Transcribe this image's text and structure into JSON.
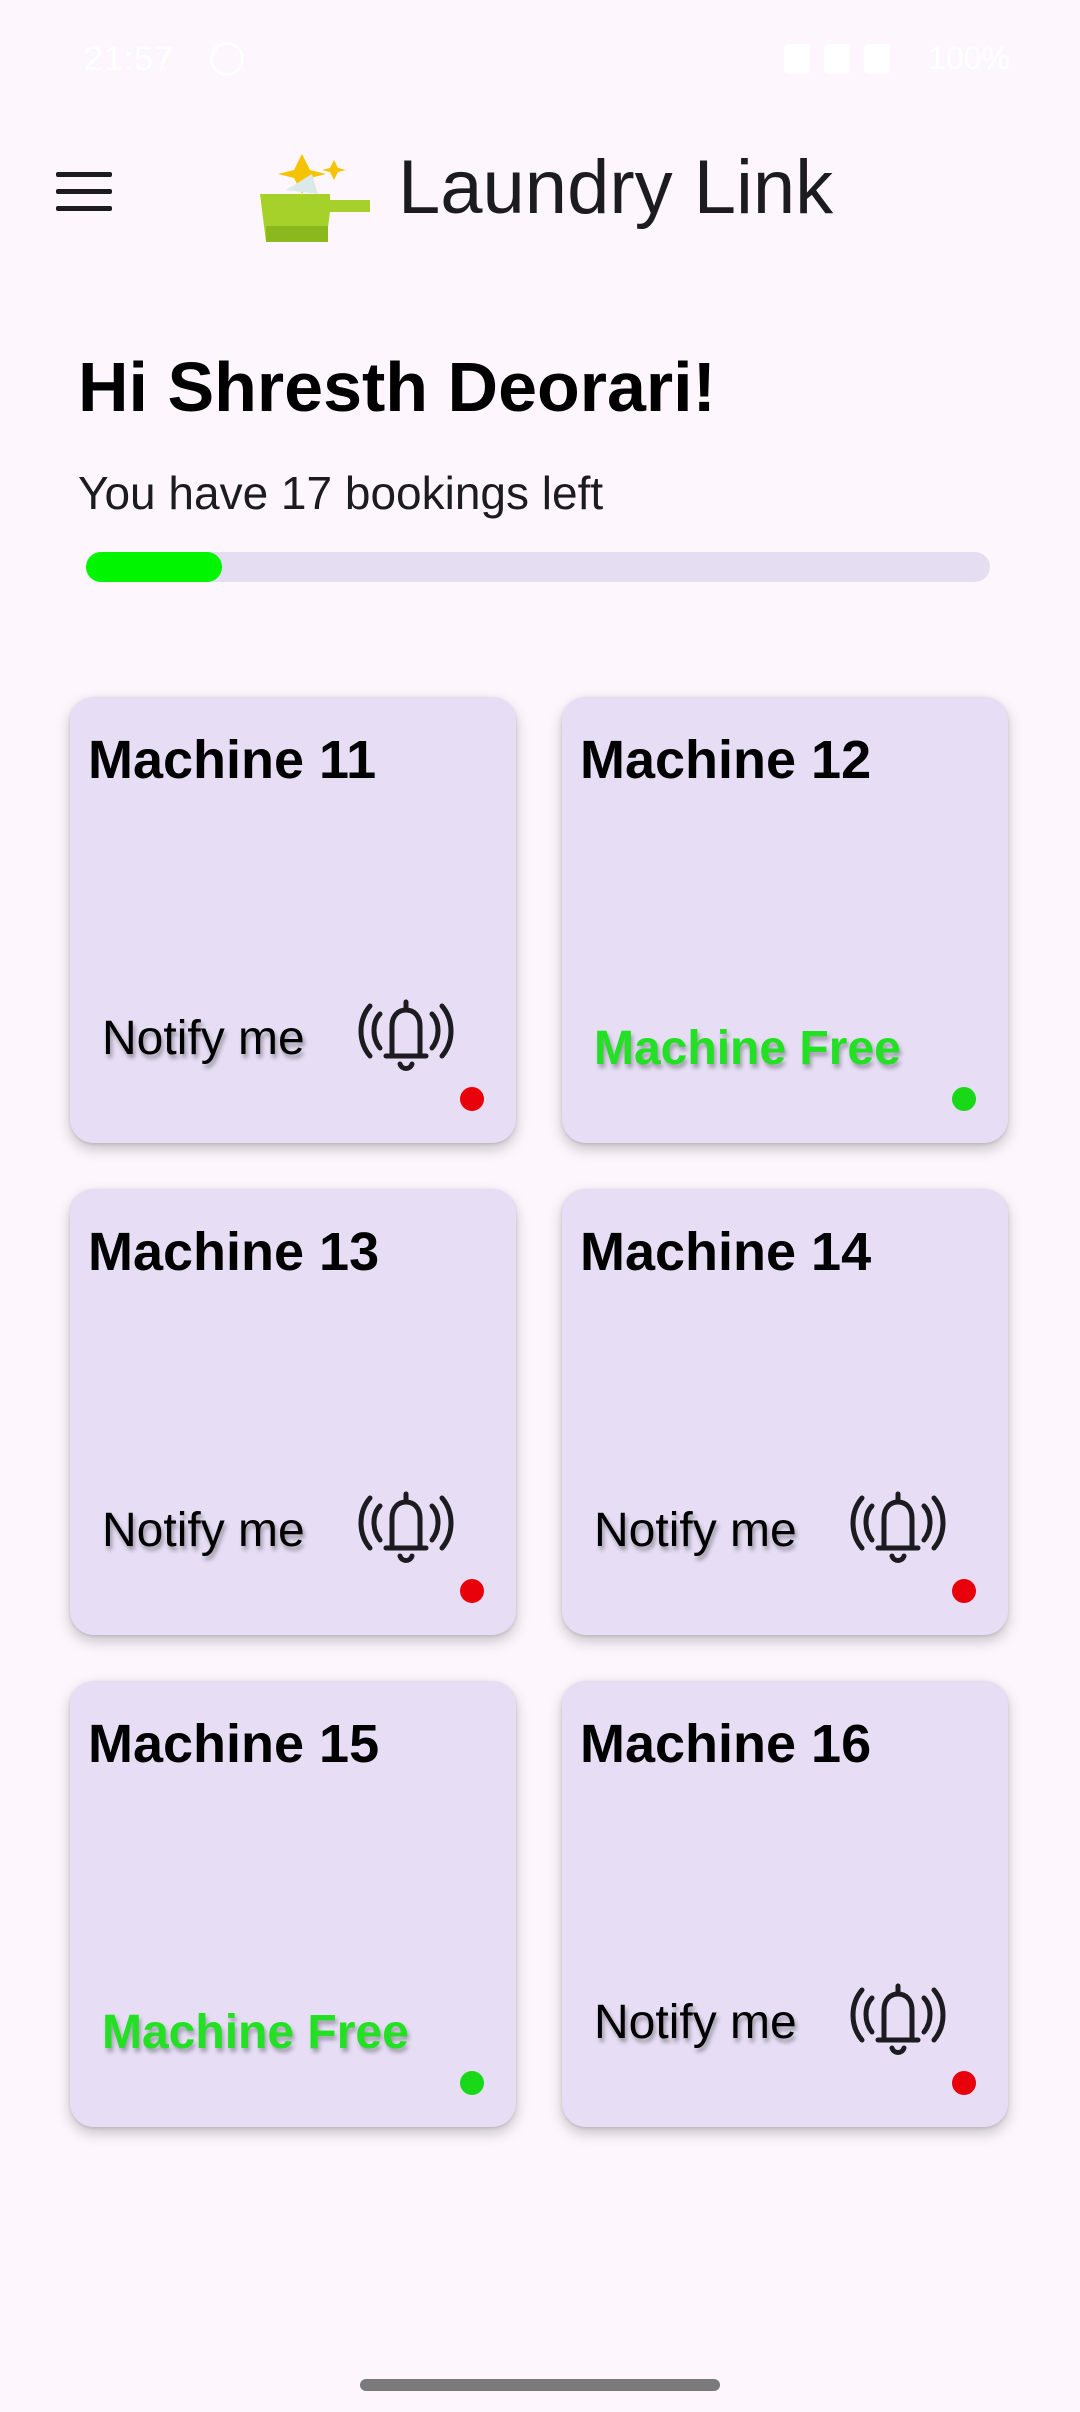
{
  "status_bar": {
    "time": "21:57",
    "battery": "100%"
  },
  "app": {
    "title": "Laundry Link"
  },
  "greeting": "Hi Shresth Deorari!",
  "bookings": {
    "text": "You have 17 bookings left",
    "progress_fraction": 0.15
  },
  "colors": {
    "busy_dot": "#e8000b",
    "free_dot": "#18d818",
    "free_text": "#22e022",
    "card_bg": "#e7def5"
  },
  "machines": [
    {
      "name": "Machine 11",
      "status": "busy",
      "action_label": "Notify me"
    },
    {
      "name": "Machine 12",
      "status": "free",
      "action_label": "Machine Free"
    },
    {
      "name": "Machine 13",
      "status": "busy",
      "action_label": "Notify me"
    },
    {
      "name": "Machine 14",
      "status": "busy",
      "action_label": "Notify me"
    },
    {
      "name": "Machine 15",
      "status": "free",
      "action_label": "Machine Free"
    },
    {
      "name": "Machine 16",
      "status": "busy",
      "action_label": "Notify me"
    }
  ],
  "icons": {
    "menu": "menu-icon",
    "logo": "laundry-detergent-icon",
    "notify": "bell-ringing-icon"
  }
}
